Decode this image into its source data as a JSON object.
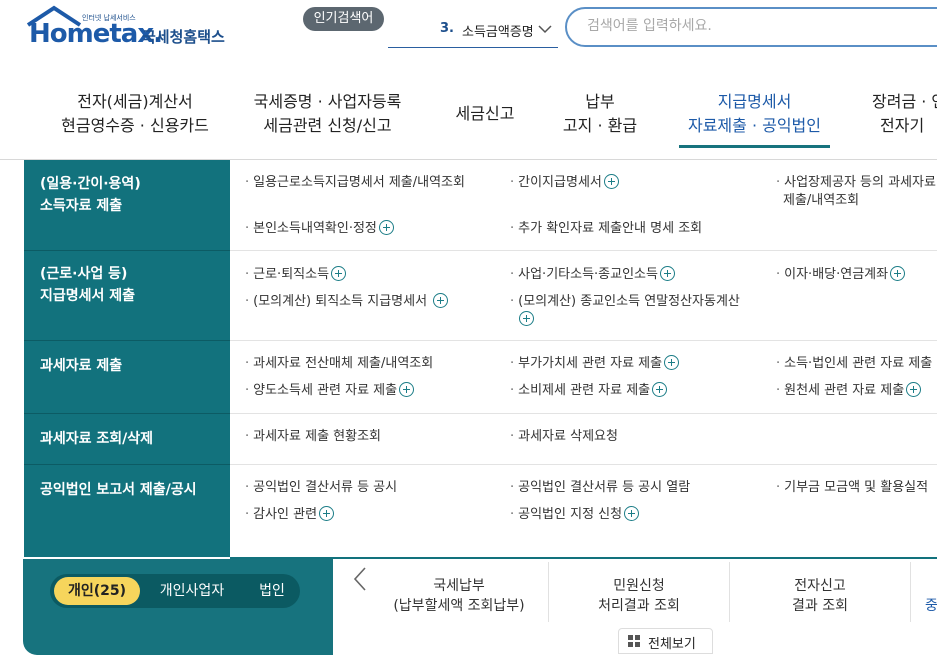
{
  "header": {
    "logo_tagline": "인터넷 납세서비스",
    "logo_text": "Hometax.",
    "logo_korean": "국세청홈택스",
    "popular_badge": "인기검색어",
    "popular_keyword_num": "3.",
    "popular_keyword": "소득금액증명",
    "search_placeholder": "검색어를 입력하세요."
  },
  "nav": [
    {
      "line1": "전자(세금)계산서",
      "line2": "현금영수증 · 신용카드"
    },
    {
      "line1": "국세증명 · 사업자등록",
      "line2": "세금관련 신청/신고"
    },
    {
      "line1": "세금신고",
      "line2": ""
    },
    {
      "line1": "납부",
      "line2": "고지 · 환급"
    },
    {
      "line1": "지급명세서",
      "line2": "자료제출 · 공익법인"
    },
    {
      "line1": "장려금 · 연",
      "line2": "전자기"
    }
  ],
  "menu": {
    "categories": [
      {
        "line1": "(일용·간이·용역)",
        "line2": "소득자료 제출"
      },
      {
        "line1": "(근로·사업 등)",
        "line2": "지급명세서 제출"
      },
      {
        "line1": "과세자료 제출",
        "line2": ""
      },
      {
        "line1": "과세자료 조회/삭제",
        "line2": ""
      },
      {
        "line1": "공익법인 보고서 제출/공시",
        "line2": ""
      }
    ],
    "links": {
      "r1a": "일용근로소득지급명세서 제출/내역조회",
      "r1b": "간이지급명세서",
      "r1c": "사업장제공자 등의 과세자료",
      "r1c2": "제출/내역조회",
      "r1d": "본인소득내역확인·정정",
      "r1e": "추가 확인자료 제출안내 명세 조회",
      "r2a": "근로·퇴직소득",
      "r2b": "사업·기타소득·종교인소득",
      "r2c": "이자·배당·연금계좌",
      "r2d": "(모의계산) 퇴직소득 지급명세서",
      "r2e": "(모의계산) 종교인소득 연말정산자동계산",
      "r3a": "과세자료 전산매체 제출/내역조회",
      "r3b": "부가가치세 관련 자료 제출",
      "r3c": "소득·법인세 관련 자료 제출",
      "r3d": "양도소득세 관련 자료 제출",
      "r3e": "소비제세 관련 자료 제출",
      "r3f": "원천세 관련 자료 제출",
      "r4a": "과세자료 제출 현황조회",
      "r4b": "과세자료 삭제요청",
      "r5a": "공익법인 결산서류 등 공시",
      "r5b": "공익법인 결산서류 등 공시 열람",
      "r5c": "기부금 모금액 및 활용실적",
      "r5d": "감사인 관련",
      "r5e": "공익법인 지정 신청"
    }
  },
  "bottom": {
    "toggle": [
      "개인(25)",
      "개인사업자",
      "법인"
    ],
    "services": [
      {
        "line1": "국세납부",
        "line2": "(납부할세액 조회납부)"
      },
      {
        "line1": "민원신청",
        "line2": "처리결과 조회"
      },
      {
        "line1": "전자신고",
        "line2": "결과 조회"
      },
      {
        "line1": "중",
        "line2": ""
      }
    ],
    "view_all": "전체보기"
  },
  "colors": {
    "teal": "#12727d",
    "brand_blue": "#1d5aa8",
    "toggle_active": "#f6d55c"
  }
}
